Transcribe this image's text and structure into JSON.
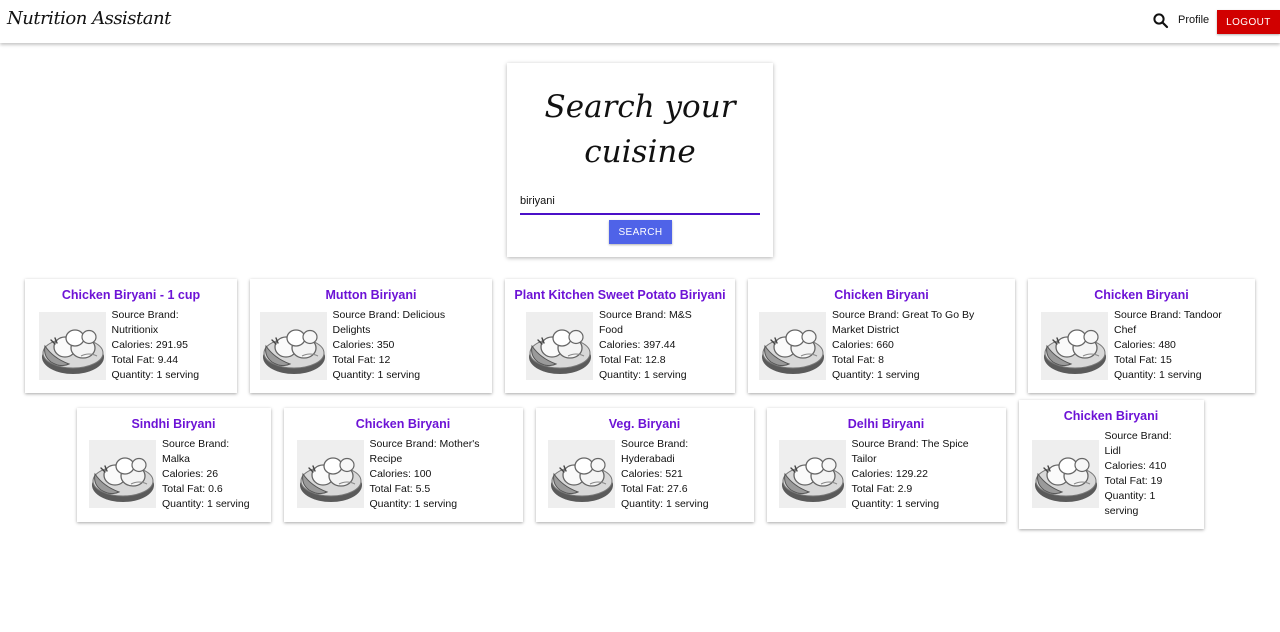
{
  "nav": {
    "brand": "Nutrition Assistant",
    "profile": "Profile",
    "logout": "LOGOUT"
  },
  "search": {
    "title": "Search your cuisine",
    "value": "biriyani",
    "button": "SEARCH"
  },
  "labels": {
    "brand": "Source Brand: ",
    "calories": "Calories: ",
    "fat": "Total Fat: ",
    "quantity": "Quantity: "
  },
  "results": [
    {
      "name": "Chicken Biryani - 1 cup",
      "brand": "Nutritionix",
      "calories": "291.95",
      "fat": "9.44",
      "quantity": "1 serving"
    },
    {
      "name": "Mutton Biriyani",
      "brand": "Delicious Delights",
      "calories": "350",
      "fat": "12",
      "quantity": "1 serving"
    },
    {
      "name": "Plant Kitchen Sweet Potato Biriyani",
      "brand": "M&S Food",
      "calories": "397.44",
      "fat": "12.8",
      "quantity": "1 serving"
    },
    {
      "name": "Chicken Biryani",
      "brand": "Great To Go By Market District",
      "calories": "660",
      "fat": "8",
      "quantity": "1 serving"
    },
    {
      "name": "Chicken Biryani",
      "brand": "Tandoor Chef",
      "calories": "480",
      "fat": "15",
      "quantity": "1 serving"
    },
    {
      "name": "Sindhi Biryani",
      "brand": "Malka",
      "calories": "26",
      "fat": "0.6",
      "quantity": "1 serving"
    },
    {
      "name": "Chicken Biryani",
      "brand": "Mother's Recipe",
      "calories": "100",
      "fat": "5.5",
      "quantity": "1 serving"
    },
    {
      "name": "Veg. Biryani",
      "brand": "Hyderabadi",
      "calories": "521",
      "fat": "27.6",
      "quantity": "1 serving"
    },
    {
      "name": "Delhi Biryani",
      "brand": "The Spice Tailor",
      "calories": "129.22",
      "fat": "2.9",
      "quantity": "1 serving"
    },
    {
      "name": "Chicken Biryani",
      "brand": "Lidl",
      "calories": "410",
      "fat": "19",
      "quantity": "1 serving"
    }
  ]
}
